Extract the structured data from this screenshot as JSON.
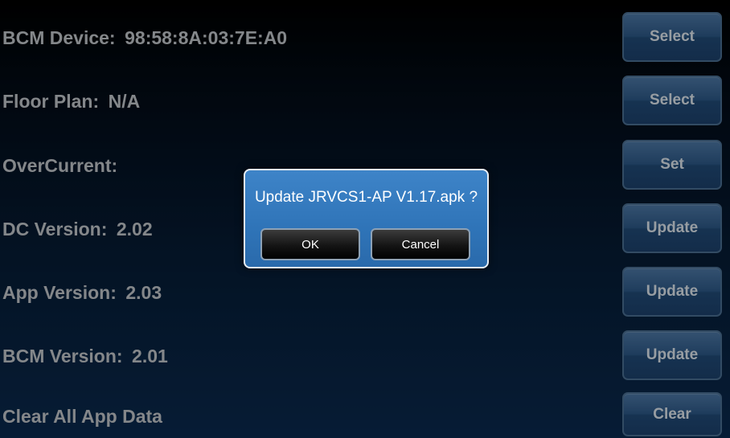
{
  "rows": [
    {
      "label": "BCM Device:",
      "value": "98:58:8A:03:7E:A0",
      "button": "Select"
    },
    {
      "label": "Floor Plan:",
      "value": "N/A",
      "button": "Select"
    },
    {
      "label": "OverCurrent:",
      "value": "",
      "button": "Set"
    },
    {
      "label": "DC Version:",
      "value": "2.02",
      "button": "Update"
    },
    {
      "label": "App Version:",
      "value": "2.03",
      "button": "Update"
    },
    {
      "label": "BCM Version:",
      "value": "2.01",
      "button": "Update"
    },
    {
      "label": "Clear All App Data",
      "value": "",
      "button": "Clear"
    }
  ],
  "dialog": {
    "message": "Update JRVCS1-AP V1.17.apk ?",
    "ok_label": "OK",
    "cancel_label": "Cancel"
  },
  "colors": {
    "dialog_bg": "#2f74b8",
    "button_blue": "#2e5a89"
  }
}
